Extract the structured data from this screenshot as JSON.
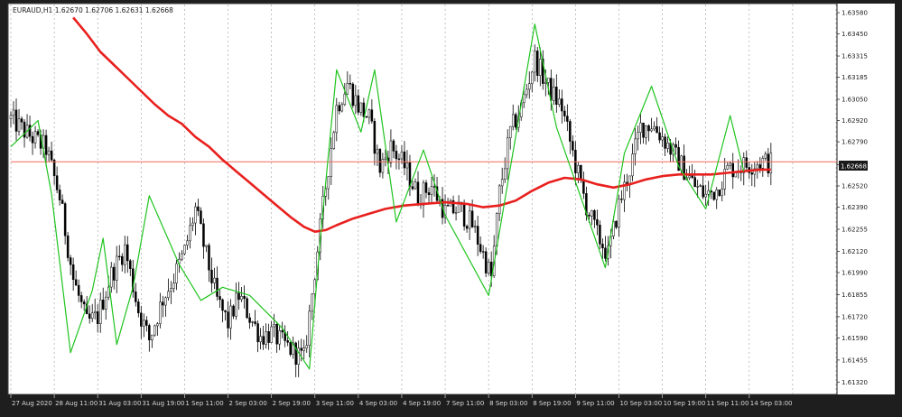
{
  "chart_data": {
    "type": "line",
    "title": "EURAUD,H1  1.62670 1.62706 1.62631 1.62668",
    "xlabel": "",
    "ylabel": "",
    "grid": true,
    "ylim": [
      1.6125,
      1.6363
    ],
    "current_price": 1.62668,
    "current_price_label": "1.62668",
    "x_ticks": [
      {
        "i": 0,
        "label": "27 Aug 2020"
      },
      {
        "i": 16,
        "label": "28 Aug 11:00"
      },
      {
        "i": 32,
        "label": "31 Aug 03:00"
      },
      {
        "i": 48,
        "label": "31 Aug 19:00"
      },
      {
        "i": 64,
        "label": "1 Sep 11:00"
      },
      {
        "i": 80,
        "label": "2 Sep 03:00"
      },
      {
        "i": 96,
        "label": "2 Sep 19:00"
      },
      {
        "i": 112,
        "label": "3 Sep 11:00"
      },
      {
        "i": 128,
        "label": "4 Sep 03:00"
      },
      {
        "i": 144,
        "label": "4 Sep 19:00"
      },
      {
        "i": 160,
        "label": "7 Sep 11:00"
      },
      {
        "i": 176,
        "label": "8 Sep 03:00"
      },
      {
        "i": 192,
        "label": "8 Sep 19:00"
      },
      {
        "i": 208,
        "label": "9 Sep 11:00"
      },
      {
        "i": 224,
        "label": "10 Sep 03:00"
      },
      {
        "i": 240,
        "label": "10 Sep 19:00"
      },
      {
        "i": 256,
        "label": "11 Sep 11:00"
      },
      {
        "i": 272,
        "label": "14 Sep 03:00"
      }
    ],
    "y_ticks": [
      1.6358,
      1.6345,
      1.63315,
      1.63185,
      1.6305,
      1.6292,
      1.6279,
      1.6265,
      1.6252,
      1.6239,
      1.62255,
      1.6212,
      1.6199,
      1.61855,
      1.6172,
      1.6159,
      1.61455,
      1.6132
    ],
    "y_tick_labels": [
      "1.63580",
      "1.63450",
      "1.63315",
      "1.63185",
      "1.63050",
      "1.62920",
      "1.62790",
      "1.62650",
      "1.62520",
      "1.62390",
      "1.62255",
      "1.62120",
      "1.61990",
      "1.61855",
      "1.61720",
      "1.61590",
      "1.61455",
      "1.61320"
    ],
    "price_path": [
      [
        0,
        1.6293
      ],
      [
        6,
        1.6284
      ],
      [
        13,
        1.6275
      ],
      [
        18,
        1.6245
      ],
      [
        23,
        1.6195
      ],
      [
        28,
        1.6168
      ],
      [
        32,
        1.6172
      ],
      [
        37,
        1.6198
      ],
      [
        42,
        1.6214
      ],
      [
        47,
        1.6176
      ],
      [
        51,
        1.6158
      ],
      [
        56,
        1.6183
      ],
      [
        60,
        1.6196
      ],
      [
        64,
        1.6212
      ],
      [
        68,
        1.6238
      ],
      [
        72,
        1.6209
      ],
      [
        76,
        1.6182
      ],
      [
        80,
        1.6168
      ],
      [
        84,
        1.6185
      ],
      [
        88,
        1.6172
      ],
      [
        92,
        1.616
      ],
      [
        96,
        1.6162
      ],
      [
        100,
        1.6156
      ],
      [
        104,
        1.6151
      ],
      [
        108,
        1.6146
      ],
      [
        112,
        1.62
      ],
      [
        116,
        1.6252
      ],
      [
        120,
        1.63
      ],
      [
        124,
        1.6315
      ],
      [
        128,
        1.6301
      ],
      [
        132,
        1.6293
      ],
      [
        136,
        1.6263
      ],
      [
        140,
        1.6276
      ],
      [
        145,
        1.6264
      ],
      [
        150,
        1.6246
      ],
      [
        155,
        1.6252
      ],
      [
        160,
        1.6236
      ],
      [
        165,
        1.6238
      ],
      [
        170,
        1.6228
      ],
      [
        174,
        1.621
      ],
      [
        177,
        1.6196
      ],
      [
        180,
        1.6248
      ],
      [
        184,
        1.6285
      ],
      [
        188,
        1.63
      ],
      [
        193,
        1.633
      ],
      [
        198,
        1.6312
      ],
      [
        203,
        1.63
      ],
      [
        208,
        1.6265
      ],
      [
        212,
        1.624
      ],
      [
        216,
        1.6222
      ],
      [
        220,
        1.621
      ],
      [
        224,
        1.624
      ],
      [
        228,
        1.6262
      ],
      [
        232,
        1.6288
      ],
      [
        236,
        1.629
      ],
      [
        240,
        1.6282
      ],
      [
        244,
        1.6272
      ],
      [
        248,
        1.6262
      ],
      [
        252,
        1.6252
      ],
      [
        256,
        1.6246
      ],
      [
        260,
        1.625
      ],
      [
        264,
        1.6262
      ],
      [
        268,
        1.6264
      ],
      [
        272,
        1.6265
      ],
      [
        276,
        1.6267
      ],
      [
        280,
        1.6266
      ]
    ],
    "series": [
      {
        "color": "#e8201e",
        "points": [
          [
            23,
            1.6355
          ],
          [
            28,
            1.6345
          ],
          [
            33,
            1.6334
          ],
          [
            38,
            1.6326
          ],
          [
            43,
            1.6318
          ],
          [
            48,
            1.631
          ],
          [
            53,
            1.6302
          ],
          [
            58,
            1.6295
          ],
          [
            63,
            1.629
          ],
          [
            68,
            1.6282
          ],
          [
            73,
            1.6276
          ],
          [
            78,
            1.6268
          ],
          [
            83,
            1.6261
          ],
          [
            88,
            1.6254
          ],
          [
            93,
            1.6247
          ],
          [
            98,
            1.624
          ],
          [
            103,
            1.6233
          ],
          [
            108,
            1.6227
          ],
          [
            112,
            1.6224
          ],
          [
            116,
            1.6225
          ],
          [
            120,
            1.6228
          ],
          [
            126,
            1.6232
          ],
          [
            132,
            1.6235
          ],
          [
            138,
            1.6238
          ],
          [
            145,
            1.624
          ],
          [
            152,
            1.6241
          ],
          [
            160,
            1.6242
          ],
          [
            168,
            1.6241
          ],
          [
            174,
            1.6239
          ],
          [
            180,
            1.624
          ],
          [
            186,
            1.6243
          ],
          [
            192,
            1.6249
          ],
          [
            198,
            1.6254
          ],
          [
            204,
            1.6257
          ],
          [
            210,
            1.6256
          ],
          [
            216,
            1.6253
          ],
          [
            222,
            1.6251
          ],
          [
            228,
            1.6253
          ],
          [
            234,
            1.6256
          ],
          [
            240,
            1.6258
          ],
          [
            246,
            1.6259
          ],
          [
            252,
            1.6259
          ],
          [
            258,
            1.6259
          ],
          [
            264,
            1.626
          ],
          [
            270,
            1.6261
          ],
          [
            276,
            1.6262
          ],
          [
            280,
            1.6262
          ]
        ]
      },
      {
        "color": "#1fc41f",
        "points": [
          [
            0,
            1.6276
          ],
          [
            10,
            1.6292
          ],
          [
            15,
            1.6247
          ],
          [
            22,
            1.615
          ],
          [
            30,
            1.6188
          ],
          [
            34,
            1.622
          ],
          [
            39,
            1.6155
          ],
          [
            45,
            1.619
          ],
          [
            51,
            1.6246
          ],
          [
            62,
            1.6204
          ],
          [
            70,
            1.6182
          ],
          [
            78,
            1.619
          ],
          [
            88,
            1.6185
          ],
          [
            100,
            1.6165
          ],
          [
            110,
            1.614
          ],
          [
            114,
            1.622
          ],
          [
            120,
            1.6323
          ],
          [
            129,
            1.6285
          ],
          [
            134,
            1.6323
          ],
          [
            142,
            1.623
          ],
          [
            152,
            1.6274
          ],
          [
            160,
            1.6234
          ],
          [
            176,
            1.6185
          ],
          [
            193,
            1.6351
          ],
          [
            201,
            1.6288
          ],
          [
            219,
            1.6202
          ],
          [
            226,
            1.6272
          ],
          [
            236,
            1.6313
          ],
          [
            246,
            1.6264
          ],
          [
            256,
            1.6238
          ],
          [
            265,
            1.6295
          ],
          [
            270,
            1.6261
          ]
        ]
      }
    ]
  }
}
